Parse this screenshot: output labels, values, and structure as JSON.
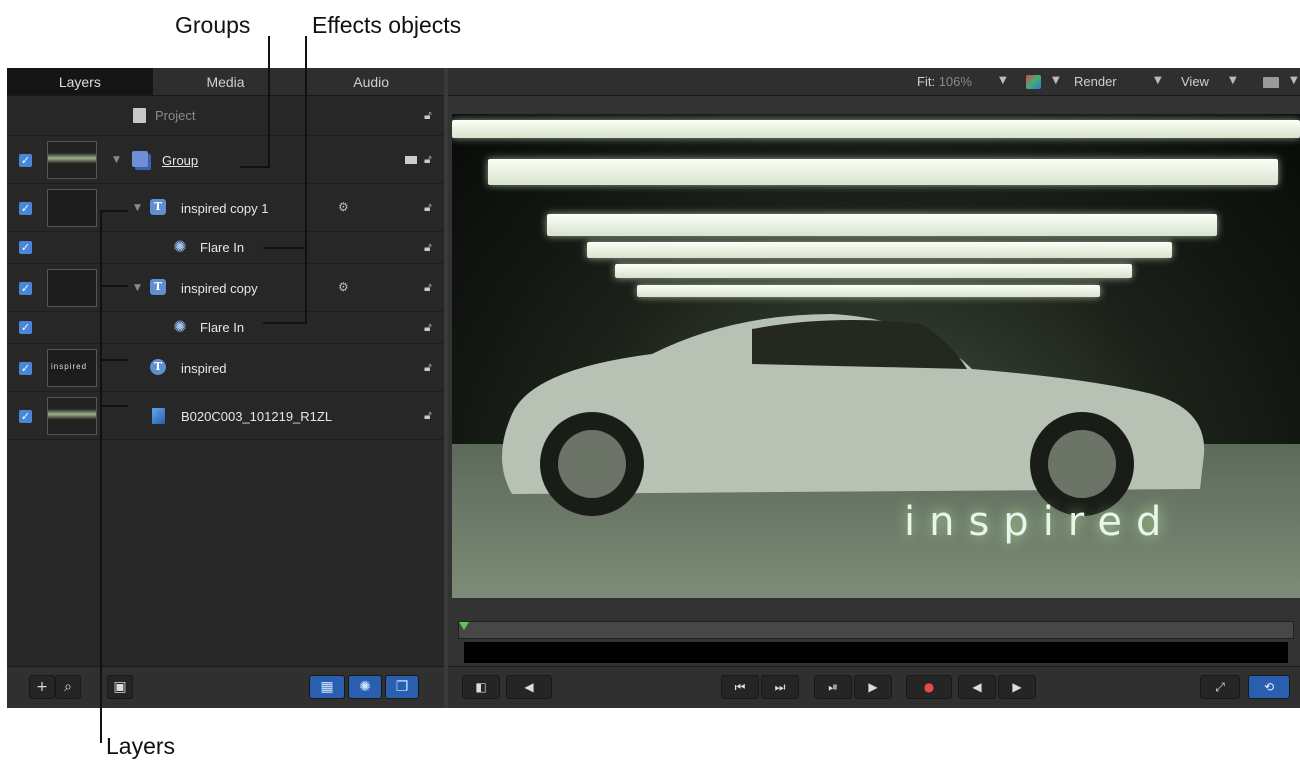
{
  "callouts": {
    "groups": "Groups",
    "effects_objects": "Effects objects",
    "layers": "Layers"
  },
  "tabs": [
    {
      "label": "Layers",
      "active": true
    },
    {
      "label": "Media",
      "active": false
    },
    {
      "label": "Audio",
      "active": false
    }
  ],
  "layers": {
    "project": "Project",
    "group": "Group",
    "text1": "inspired copy 1",
    "flare1": "Flare In",
    "text2": "inspired copy",
    "flare2": "Flare In",
    "text3": "inspired",
    "video": "B020C003_101219_R1ZL"
  },
  "thumbs": {
    "text3_thumb": "inspired"
  },
  "toolbar": {
    "fit_label": "Fit:",
    "fit_value": "106%",
    "render": "Render",
    "view": "View"
  },
  "canvas": {
    "overlay_text": "inspired"
  },
  "icons": {
    "lock": "lock-icon",
    "gear": "gear-icon",
    "effect": "effect-icon",
    "text": "text-layer-icon",
    "group": "group-icon",
    "video": "video-clip-icon"
  },
  "colors": {
    "accent": "#4a86d8",
    "record": "#e64a4a",
    "playhead": "#5ac85a"
  }
}
